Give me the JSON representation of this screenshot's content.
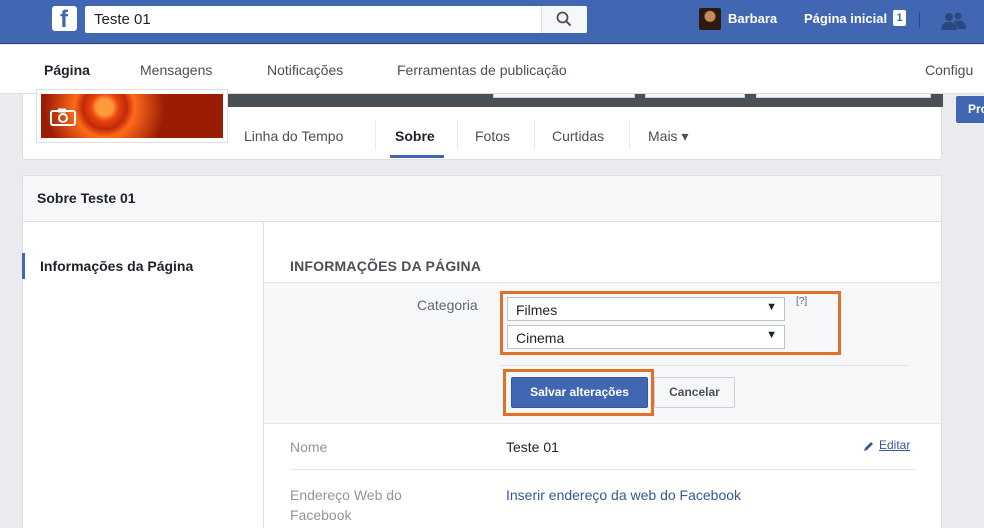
{
  "topbar": {
    "search_value": "Teste 01",
    "user_name": "Barbara",
    "home_label": "Página inicial",
    "home_badge": "1"
  },
  "page_nav": {
    "tabs": [
      {
        "label": "Página",
        "active": true
      },
      {
        "label": "Mensagens"
      },
      {
        "label": "Notificações"
      },
      {
        "label": "Ferramentas de publicação"
      },
      {
        "label": "Configu"
      }
    ]
  },
  "cover_tabs": [
    {
      "label": "Linha do Tempo"
    },
    {
      "label": "Sobre",
      "active": true
    },
    {
      "label": "Fotos"
    },
    {
      "label": "Curtidas"
    },
    {
      "label": "Mais ▾"
    }
  ],
  "right_button": "Pro",
  "about": {
    "title": "Sobre Teste 01",
    "sidebar_item": "Informações da Página",
    "section_title": "INFORMAÇÕES DA PÁGINA",
    "category_label": "Categoria",
    "category_value": "Filmes",
    "subcategory_value": "Cinema",
    "help_label": "[?]",
    "save_label": "Salvar alterações",
    "cancel_label": "Cancelar",
    "name_label": "Nome",
    "name_value": "Teste 01",
    "edit_label": "Editar",
    "web_label_line1": "Endereço Web do",
    "web_label_line2": "Facebook",
    "web_link": "Inserir endereço da web do Facebook"
  },
  "colors": {
    "brand_blue": "#4267b2",
    "highlight_orange": "#e07126"
  },
  "icons": [
    "facebook-logo-icon",
    "search-icon",
    "friends-icon",
    "camera-icon",
    "pencil-icon",
    "caret-down-icon"
  ]
}
